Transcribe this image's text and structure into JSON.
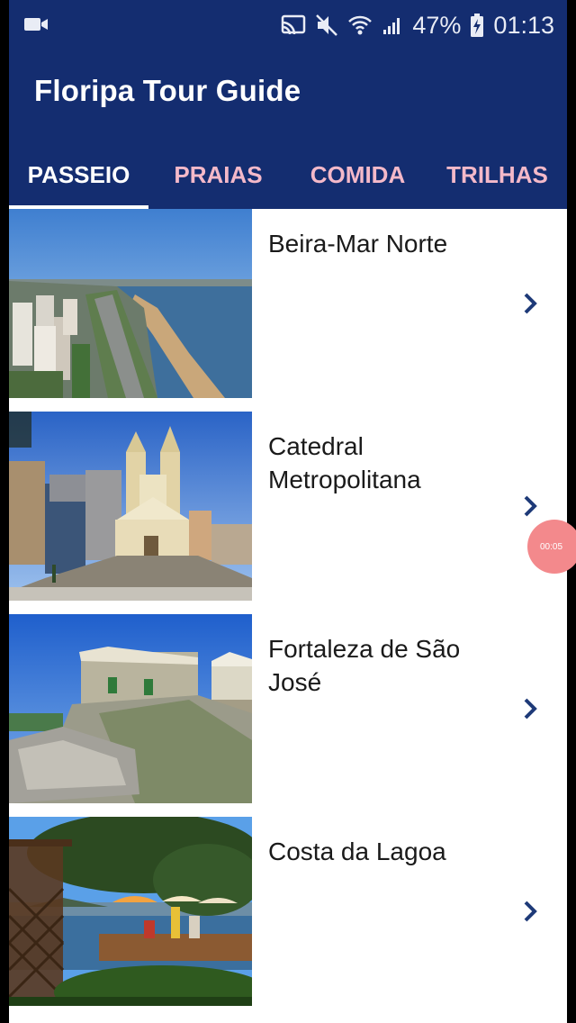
{
  "status_bar": {
    "battery": "47%",
    "time": "01:13",
    "icons": [
      "video-icon",
      "cast-icon",
      "mute-icon",
      "wifi-icon",
      "signal-icon",
      "battery-charging-icon"
    ]
  },
  "app_bar": {
    "title": "Floripa Tour Guide"
  },
  "tabs": [
    {
      "label": "PASSEIO",
      "active": true
    },
    {
      "label": "PRAIAS",
      "active": false
    },
    {
      "label": "COMIDA",
      "active": false
    },
    {
      "label": "TRILHAS",
      "active": false
    }
  ],
  "places": [
    {
      "title": "Beira-Mar Norte"
    },
    {
      "title": "Catedral Metropolitana"
    },
    {
      "title": "Fortaleza de São José"
    },
    {
      "title": "Costa da Lagoa"
    }
  ],
  "recording_badge": "00:05",
  "colors": {
    "primary": "#142d70",
    "tab_inactive": "#f4b9c9",
    "chevron": "#1e3a78",
    "record": "#f3898c"
  }
}
